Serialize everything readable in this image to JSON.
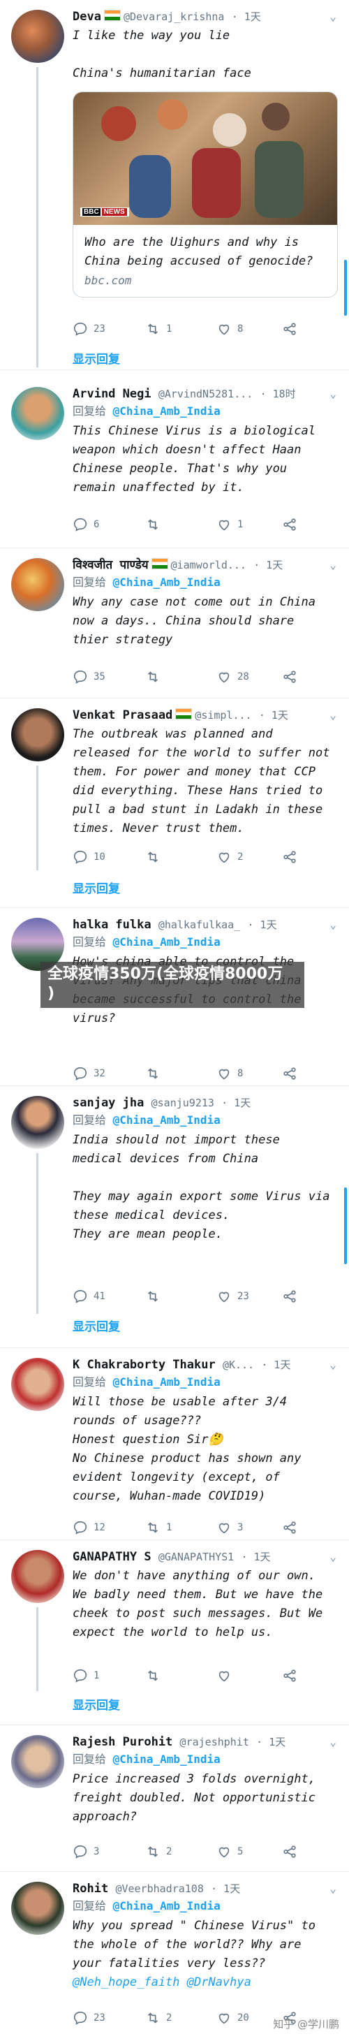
{
  "tweets": [
    {
      "name": "Deva",
      "flag": true,
      "handle": "@Devaraj_krishna",
      "time": "· 1天",
      "text": "I like the way you lie\n\nChina's humanitarian face",
      "card": {
        "title": "Who are the Uighurs and why is China being accused of genocide?",
        "domain": "bbc.com",
        "badge_b": "BBC",
        "badge_n": "NEWS"
      },
      "counts": {
        "reply": "23",
        "retweet": "1",
        "like": "8"
      },
      "show_thread": "显示回复"
    },
    {
      "name": "Arvind Negi",
      "handle": "@ArvindN5281...",
      "time": "· 18时",
      "reply_prefix": "回复给",
      "reply_to": "@China_Amb_India",
      "text": "This Chinese Virus is a biological weapon which doesn't affect Haan Chinese people. That's why you remain unaffected  by it.",
      "counts": {
        "reply": "6",
        "retweet": "",
        "like": "1"
      }
    },
    {
      "name": "विश्वजीत पाण्डेय",
      "flag": true,
      "handle": "@iamworld...",
      "time": "· 1天",
      "reply_prefix": "回复给",
      "reply_to": "@China_Amb_India",
      "text": "Why any case not come out in China now a days.. China should share thier strategy",
      "counts": {
        "reply": "35",
        "retweet": "",
        "like": "28"
      }
    },
    {
      "name": "Venkat Prasaad",
      "flag": true,
      "handle": "@simpl...",
      "time": "· 1天",
      "text": "The outbreak was planned and released for the world to suffer not them. For power and money that CCP did everything. These Hans tried to pull a bad stunt in Ladakh in these times. Never trust them.",
      "counts": {
        "reply": "10",
        "retweet": "",
        "like": "2"
      },
      "show_thread": "显示回复"
    },
    {
      "name": "halka fulka",
      "handle": "@halkafulkaa_",
      "time": "· 1天",
      "reply_prefix": "回复给",
      "reply_to": "@China_Amb_India",
      "text": "How's china able to control the virus? Any major tips that china became successful to control the virus?",
      "counts": {
        "reply": "32",
        "retweet": "",
        "like": "8"
      }
    },
    {
      "name": "sanjay    jha",
      "handle": "@sanju9213",
      "time": "· 1天",
      "reply_prefix": "回复给",
      "reply_to": "@China_Amb_India",
      "text": "India should not import these medical devices from China\n\nThey may again export some Virus via these medical devices.\nThey are mean people.",
      "counts": {
        "reply": "41",
        "retweet": "",
        "like": "23"
      },
      "show_thread": "显示回复"
    },
    {
      "name": "K Chakraborty Thakur",
      "handle": "@K...",
      "time": "· 1天",
      "reply_prefix": "回复给",
      "reply_to": "@China_Amb_India",
      "text": "Will those be usable after 3/4 rounds of usage???\nHonest question Sir🤔\nNo Chinese product has shown any evident longevity (except, of course, Wuhan-made COVID19)",
      "counts": {
        "reply": "12",
        "retweet": "1",
        "like": "3"
      }
    },
    {
      "name": "GANAPATHY S",
      "handle": "@GANAPATHYS1",
      "time": "· 1天",
      "text": "We don't have anything of our own. We badly need them. But we have the cheek to post such messages. But We expect the world to help us.",
      "counts": {
        "reply": "1",
        "retweet": "",
        "like": ""
      },
      "show_thread": "显示回复"
    },
    {
      "name": "Rajesh Purohit",
      "handle": "@rajeshphit",
      "time": "· 1天",
      "reply_prefix": "回复给",
      "reply_to": "@China_Amb_India",
      "text": "Price increased 3 folds overnight, freight doubled. Not opportunistic approach?",
      "counts": {
        "reply": "3",
        "retweet": "2",
        "like": "5"
      }
    },
    {
      "name": "Rohit",
      "handle": "@Veerbhadra108",
      "time": "· 1天",
      "reply_prefix": "回复给",
      "reply_to": "@China_Amb_India",
      "text": "Why you spread \" Chinese Virus\" to the whole of the world?? Why are your fatalities very less??",
      "mentions": "@Neh_hope_faith @DrNavhya",
      "counts": {
        "reply": "23",
        "retweet": "2",
        "like": "20"
      }
    }
  ],
  "overlay": {
    "line1": "全球疫情350万(全球疫情8000万",
    "line2": ")"
  },
  "watermark": "知乎 @学川鹏",
  "colors": {
    "accent": "#1da1f2",
    "muted": "#657786",
    "border": "#e6ecf0"
  }
}
